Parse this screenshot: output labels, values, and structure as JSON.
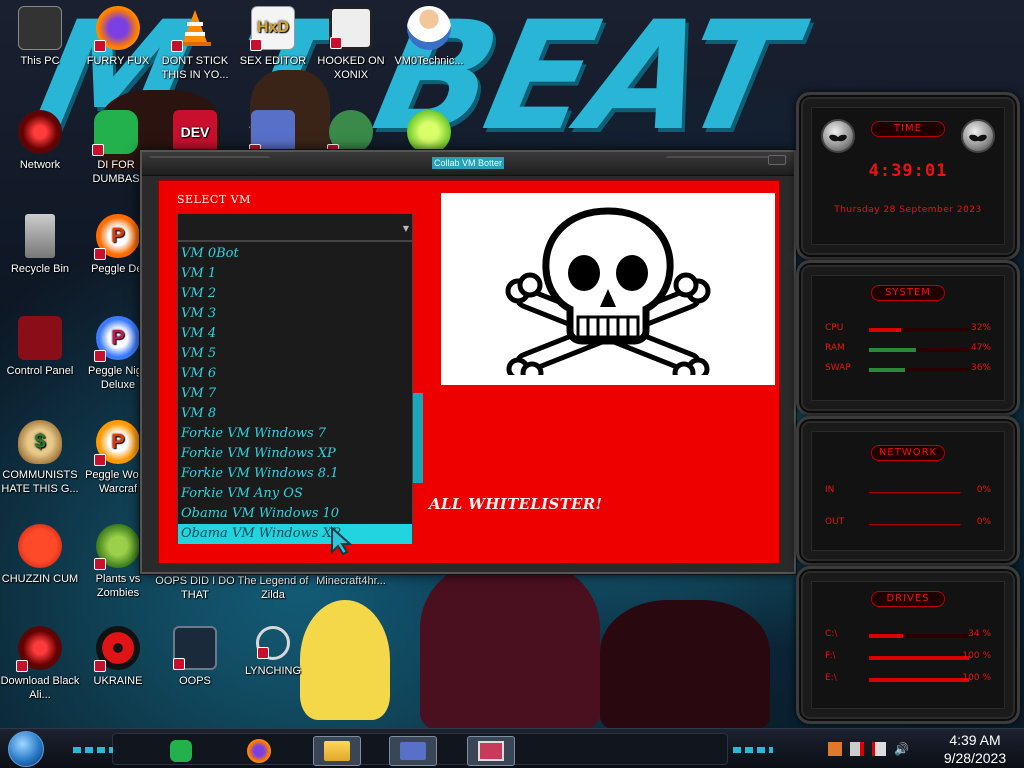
{
  "desktop": {
    "wallpaper_text": "M T BEAT",
    "icons": [
      {
        "label": "This PC",
        "icon": "computer-icon"
      },
      {
        "label": "FURRY FUX",
        "icon": "firefox-icon"
      },
      {
        "label": "DONT STICK THIS IN YO...",
        "icon": "vlc-cone-icon"
      },
      {
        "label": "SEX EDITOR",
        "icon": "hxd-editor-icon"
      },
      {
        "label": "HOOKED ON XONIX",
        "icon": "xonix-game-icon"
      },
      {
        "label": "VM0Technic...",
        "icon": "doctor-icon"
      },
      {
        "label": "Network",
        "icon": "network-icon"
      },
      {
        "label": "DI FOR DUMBAS",
        "icon": "green-doc-icon"
      },
      {
        "label": "DEV",
        "icon": "dev-cpp-icon"
      },
      {
        "label": "",
        "icon": "card-icon"
      },
      {
        "label": "",
        "icon": "santa-icon"
      },
      {
        "label": "",
        "icon": "lime-icon"
      },
      {
        "label": "Recycle Bin",
        "icon": "recycle-bin-icon"
      },
      {
        "label": "Peggle Del",
        "icon": "peggle-icon"
      },
      {
        "label": "Control Panel",
        "icon": "control-panel-icon"
      },
      {
        "label": "Peggle Nigh Deluxe",
        "icon": "peggle-icon"
      },
      {
        "label": "COMMUNISTS HATE THIS G...",
        "icon": "money-bag-icon"
      },
      {
        "label": "Peggle Wo of Warcraf",
        "icon": "peggle-icon"
      },
      {
        "label": "CHUZZIN CUM",
        "icon": "chuzzle-icon"
      },
      {
        "label": "Plants vs Zombies",
        "icon": "plant-icon"
      },
      {
        "label": "OOPS DID I DO THAT",
        "icon": "generic-icon"
      },
      {
        "label": "The Legend of Zilda",
        "icon": "generic-icon"
      },
      {
        "label": "Minecraft4hr...",
        "icon": "generic-icon"
      },
      {
        "label": "Download Black Ali...",
        "icon": "alienware-icon"
      },
      {
        "label": "UKRAINE",
        "icon": "radiation-icon"
      },
      {
        "label": "OOPS",
        "icon": "terminal-icon"
      },
      {
        "label": "LYNCHING",
        "icon": "noose-icon"
      }
    ]
  },
  "window": {
    "title": "Collab VM Botter",
    "select_label": "SELECT VM",
    "combo_value": "",
    "dropdown_options": [
      "VM 0Bot",
      "VM 1",
      "VM 2",
      "VM 3",
      "VM 4",
      "VM 5",
      "VM 6",
      "VM 7",
      "VM 8",
      "Forkie VM Windows 7",
      "Forkie VM Windows XP",
      "Forkie VM Windows 8.1",
      "Forkie VM Any OS",
      "Obama VM Windows 10",
      "Obama VM Windows XP"
    ],
    "selected_option_index": 14,
    "whitelister_text": "ALL WHITELISTER!",
    "logo": "skull-and-crossbones-icon"
  },
  "widgets": {
    "time": {
      "title": "TIME",
      "clock": "4:39:01",
      "date": "Thursday 28 September 2023"
    },
    "system": {
      "title": "SYSTEM",
      "rows": [
        {
          "label": "CPU",
          "value": "32%",
          "percent": 32
        },
        {
          "label": "RAM",
          "value": "47%",
          "percent": 47
        },
        {
          "label": "SWAP",
          "value": "36%",
          "percent": 36
        }
      ]
    },
    "network": {
      "title": "NETWORK",
      "rows": [
        {
          "label": "IN",
          "value": "0%"
        },
        {
          "label": "OUT",
          "value": "0%"
        }
      ]
    },
    "drives": {
      "title": "DRIVES",
      "rows": [
        {
          "label": "C:\\",
          "value": "34 %",
          "percent": 34
        },
        {
          "label": "F:\\",
          "value": "100 %",
          "percent": 100
        },
        {
          "label": "E:\\",
          "value": "100 %",
          "percent": 100
        }
      ]
    }
  },
  "taskbar": {
    "time": "4:39 AM",
    "date": "9/28/2023",
    "apps": [
      "green-doc-icon",
      "firefox-icon",
      "file-explorer-icon",
      "card-icon",
      "vm-window-icon"
    ]
  },
  "colors": {
    "client_bg": "#ee0000",
    "accent_cyan": "#22d3e0",
    "widget_red": "#e11111"
  }
}
